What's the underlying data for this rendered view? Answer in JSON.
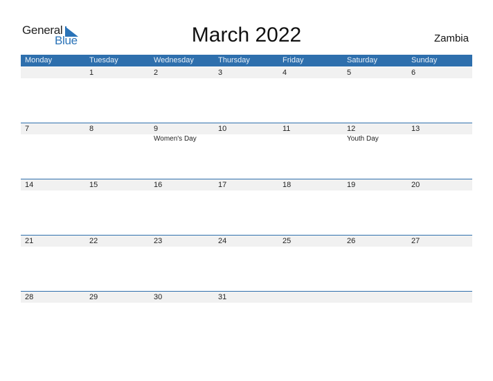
{
  "logo": {
    "line1": "General",
    "line2": "Blue"
  },
  "title": "March 2022",
  "country": "Zambia",
  "colors": {
    "accent": "#2e6fad",
    "strip": "#f1f1f1"
  },
  "weekdays": [
    "Monday",
    "Tuesday",
    "Wednesday",
    "Thursday",
    "Friday",
    "Saturday",
    "Sunday"
  ],
  "weeks": [
    {
      "days": [
        "",
        "1",
        "2",
        "3",
        "4",
        "5",
        "6"
      ],
      "events": [
        "",
        "",
        "",
        "",
        "",
        "",
        ""
      ]
    },
    {
      "days": [
        "7",
        "8",
        "9",
        "10",
        "11",
        "12",
        "13"
      ],
      "events": [
        "",
        "",
        "Women's Day",
        "",
        "",
        "Youth Day",
        ""
      ]
    },
    {
      "days": [
        "14",
        "15",
        "16",
        "17",
        "18",
        "19",
        "20"
      ],
      "events": [
        "",
        "",
        "",
        "",
        "",
        "",
        ""
      ]
    },
    {
      "days": [
        "21",
        "22",
        "23",
        "24",
        "25",
        "26",
        "27"
      ],
      "events": [
        "",
        "",
        "",
        "",
        "",
        "",
        ""
      ]
    },
    {
      "days": [
        "28",
        "29",
        "30",
        "31",
        "",
        "",
        ""
      ],
      "events": [
        "",
        "",
        "",
        "",
        "",
        "",
        ""
      ]
    }
  ]
}
